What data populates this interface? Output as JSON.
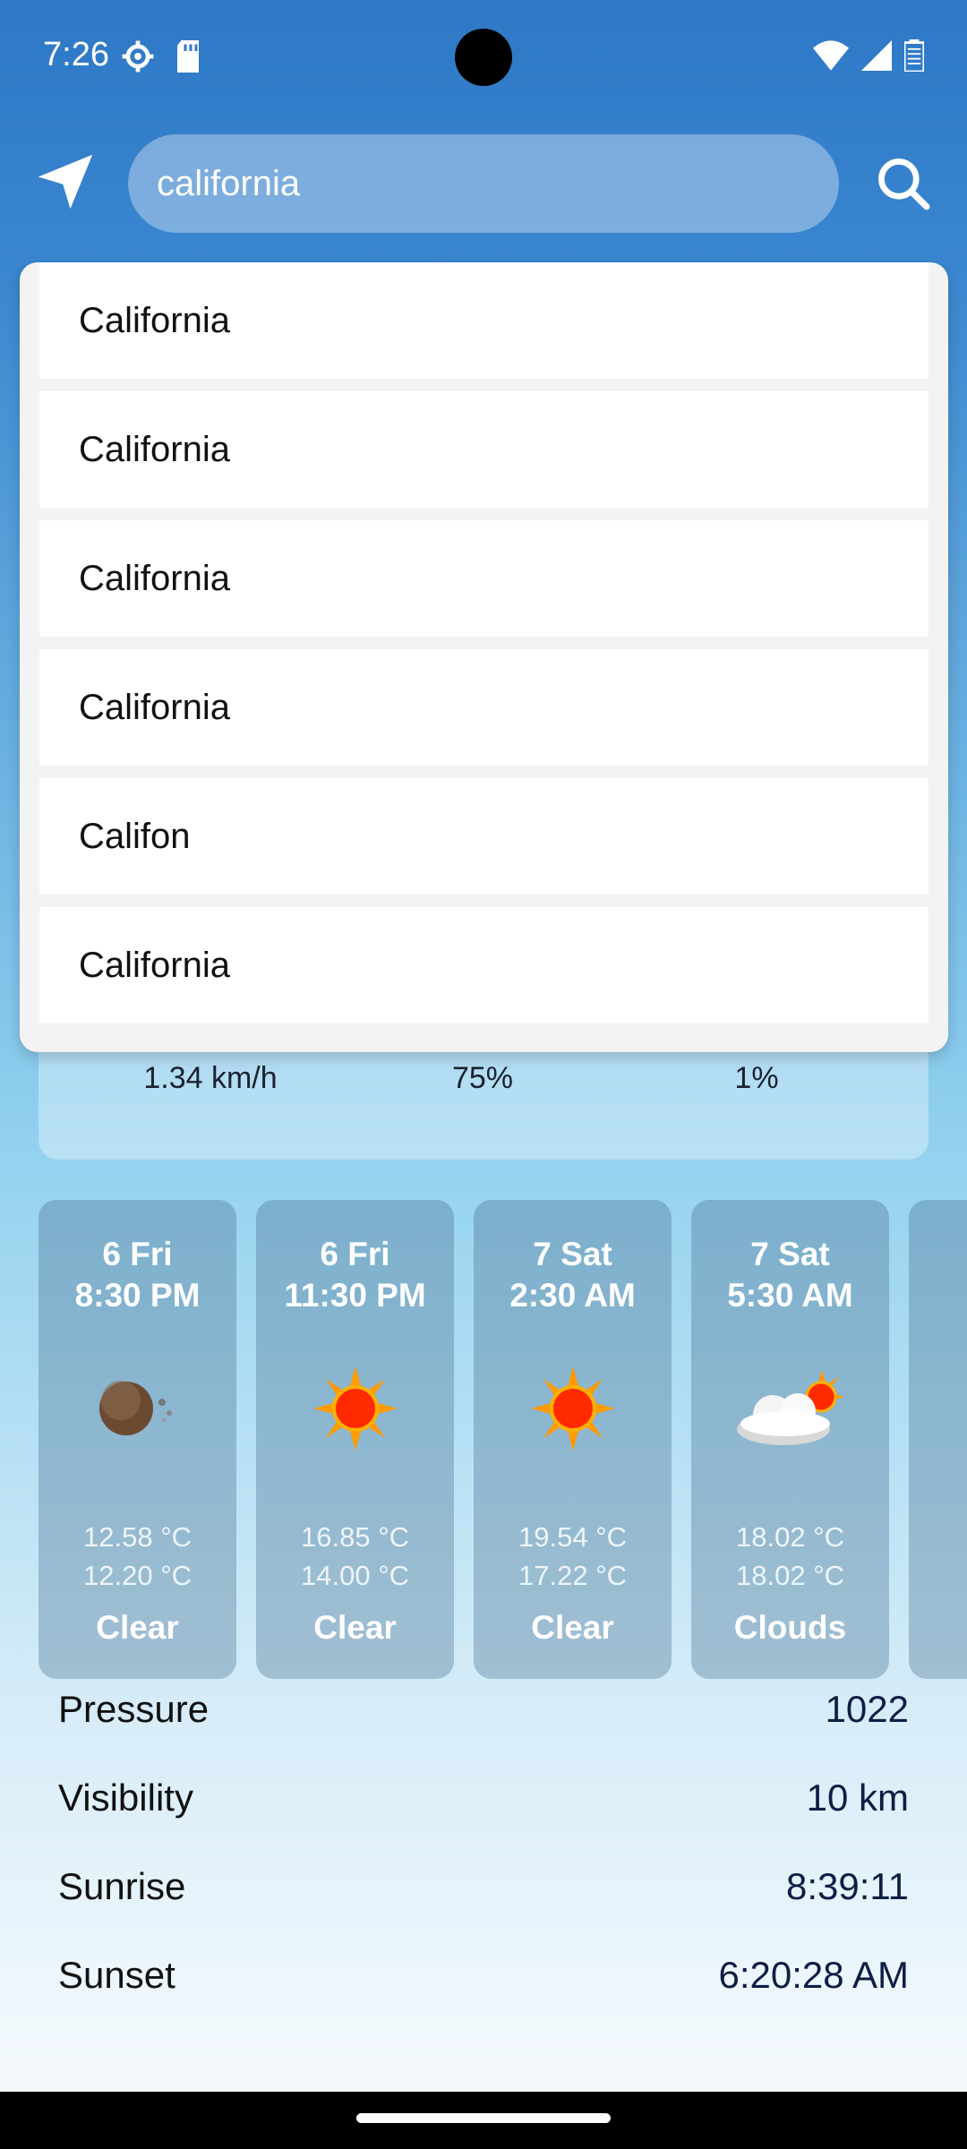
{
  "status_bar": {
    "time": "7:26",
    "left_icons": [
      "settings-icon",
      "sd-card-icon"
    ],
    "right_icons": [
      "wifi-icon",
      "signal-icon",
      "battery-icon"
    ]
  },
  "search": {
    "value": "california"
  },
  "suggestions": [
    "California",
    "California",
    "California",
    "California",
    "Califon",
    "California"
  ],
  "current_stats": {
    "wind": "1.34 km/h",
    "humidity": "75%",
    "clouds": "1%"
  },
  "forecast": [
    {
      "date": "6 Fri",
      "time": "8:30 PM",
      "icon": "moon-icon",
      "temp_max": "12.58 °C",
      "temp_min": "12.20 °C",
      "desc": "Clear"
    },
    {
      "date": "6 Fri",
      "time": "11:30 PM",
      "icon": "sun-icon",
      "temp_max": "16.85 °C",
      "temp_min": "14.00 °C",
      "desc": "Clear"
    },
    {
      "date": "7 Sat",
      "time": "2:30 AM",
      "icon": "sun-icon",
      "temp_max": "19.54 °C",
      "temp_min": "17.22 °C",
      "desc": "Clear"
    },
    {
      "date": "7 Sat",
      "time": "5:30 AM",
      "icon": "cloud-sun-icon",
      "temp_max": "18.02 °C",
      "temp_min": "18.02 °C",
      "desc": "Clouds"
    }
  ],
  "details": [
    {
      "label": "Pressure",
      "value": "1022"
    },
    {
      "label": "Visibility",
      "value": "10 km"
    },
    {
      "label": "Sunrise",
      "value": "8:39:11"
    },
    {
      "label": "Sunset",
      "value": "6:20:28 AM"
    }
  ],
  "colors": {
    "accent": "#2e78c6",
    "text_dark": "#0e1e44",
    "sun": "#ff2a00"
  }
}
